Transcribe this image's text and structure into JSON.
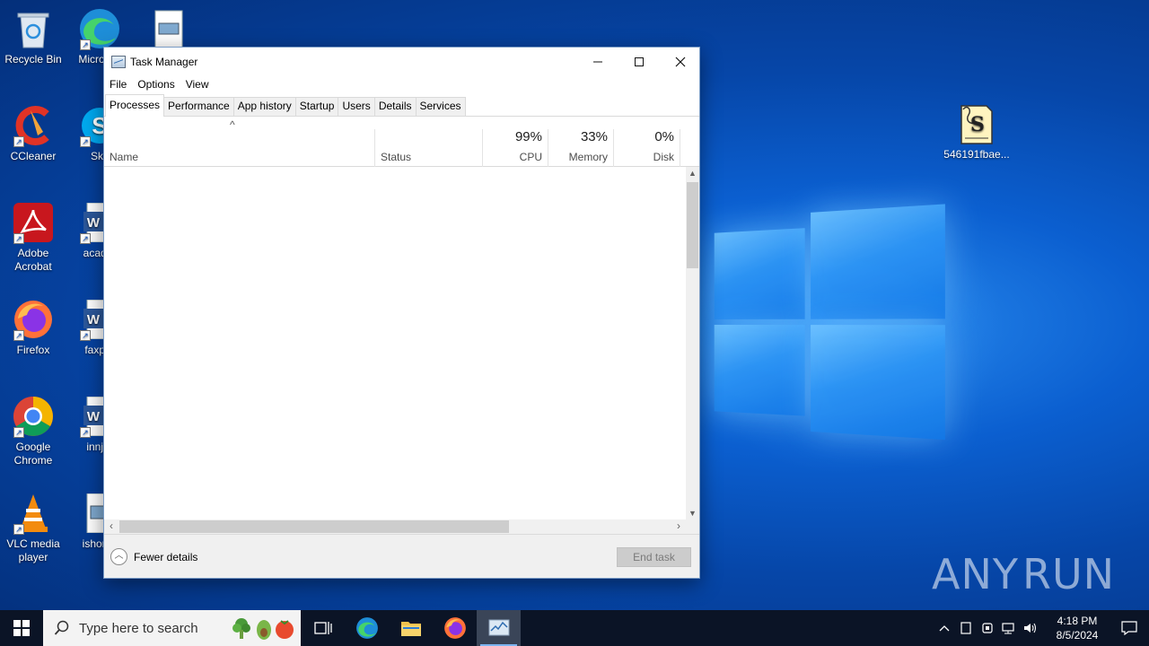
{
  "desktop": {
    "icons": [
      {
        "label": "Recycle Bin",
        "icon": "recycle-bin-icon"
      },
      {
        "label": "Micro Ed",
        "icon": "edge-icon"
      },
      {
        "label": "CCleaner",
        "icon": "ccleaner-icon"
      },
      {
        "label": "Sky",
        "icon": "skype-icon"
      },
      {
        "label": "Adobe Acrobat",
        "icon": "acrobat-icon"
      },
      {
        "label": "acader",
        "icon": "word-icon"
      },
      {
        "label": "Firefox",
        "icon": "firefox-icon"
      },
      {
        "label": "faxpro",
        "icon": "word-icon"
      },
      {
        "label": "Google Chrome",
        "icon": "chrome-icon"
      },
      {
        "label": "innjur",
        "icon": "word-icon"
      },
      {
        "label": "VLC media player",
        "icon": "vlc-icon"
      },
      {
        "label": "ishorse",
        "icon": "image-file-icon"
      },
      {
        "label": "546191fbae...",
        "icon": "script-file-icon"
      }
    ]
  },
  "window": {
    "title": "Task Manager",
    "menu": [
      "File",
      "Options",
      "View"
    ],
    "tabs": [
      "Processes",
      "Performance",
      "App history",
      "Startup",
      "Users",
      "Details",
      "Services"
    ],
    "active_tab": "Processes",
    "columns": {
      "name": "Name",
      "status": "Status",
      "cpu": {
        "percent": "99%",
        "label": "CPU"
      },
      "memory": {
        "percent": "33%",
        "label": "Memory"
      },
      "disk": {
        "percent": "0%",
        "label": "Disk"
      }
    },
    "footer": {
      "fewer_details": "Fewer details",
      "end_task": "End task"
    }
  },
  "watermark": {
    "left": "ANY",
    "right": "RUN"
  },
  "taskbar": {
    "search_placeholder": "Type here to search",
    "clock_time": "4:18 PM",
    "clock_date": "8/5/2024"
  }
}
